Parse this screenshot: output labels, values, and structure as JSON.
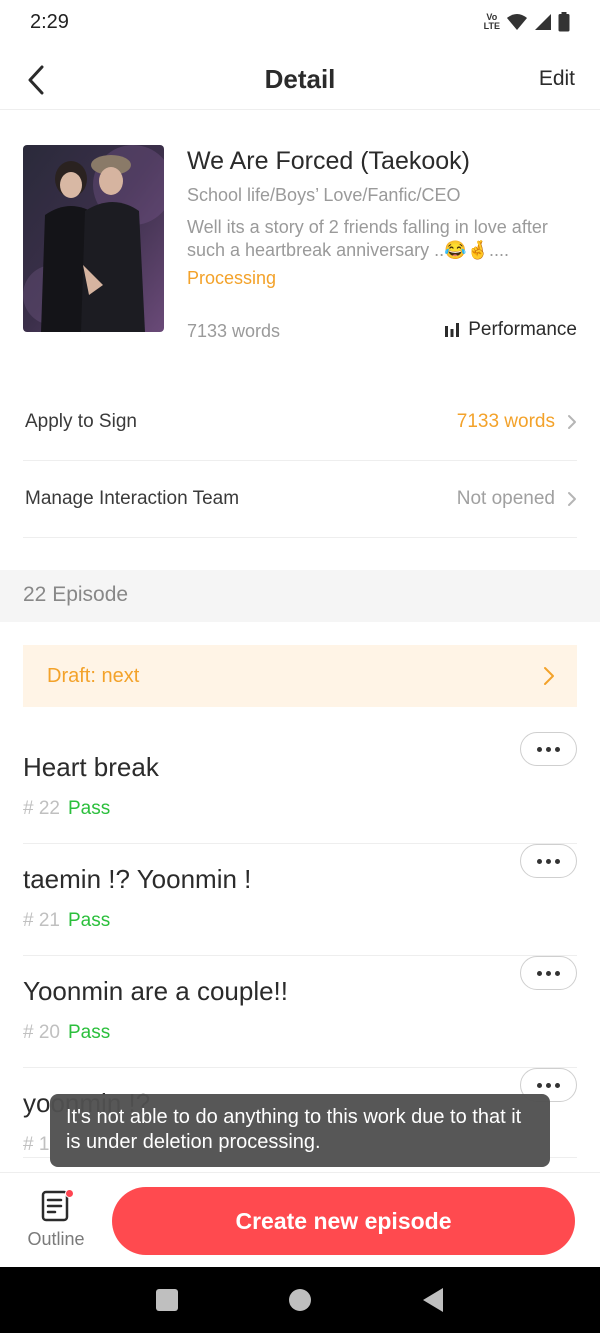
{
  "status_bar": {
    "time": "2:29",
    "volte": "Vo\nLTE",
    "icons": [
      "volte-icon",
      "wifi-icon",
      "signal-icon",
      "battery-icon"
    ]
  },
  "header": {
    "title": "Detail",
    "edit_label": "Edit",
    "back_icon": "chevron-left-icon"
  },
  "book": {
    "cover_icon": "book-cover-image",
    "title": "We Are Forced (Taekook)",
    "tags": "School life/Boys’ Love/Fanfic/CEO",
    "description": "Well its a story of 2 friends falling in love after such a heartbreak anniversary ..😂🤞....",
    "status": "Processing",
    "words": "7133 words",
    "performance_label": "Performance"
  },
  "rows": [
    {
      "label": "Apply to Sign",
      "value": "7133 words"
    },
    {
      "label": "Manage Interaction Team",
      "value": "Not opened"
    }
  ],
  "episodes_section": {
    "label": "22 Episode",
    "draft_label": "Draft: next"
  },
  "episodes": [
    {
      "title": "Heart break",
      "number": "# 22",
      "status": "Pass"
    },
    {
      "title": "taemin !? Yoonmin !",
      "number": "# 21",
      "status": "Pass"
    },
    {
      "title": "Yoonmin are a couple!!",
      "number": "# 20",
      "status": "Pass"
    },
    {
      "title": "yoonmin !?",
      "number": "# 1"
    }
  ],
  "toast": {
    "message": "It's not able to do anything to this work due to that it is under deletion processing."
  },
  "bottom_bar": {
    "outline_label": "Outline",
    "create_label": "Create new episode"
  },
  "colors": {
    "accent_orange": "#f3a22a",
    "pass_green": "#2bbf3c",
    "primary_red": "#ff4a4f",
    "draft_bg": "#fff4e6"
  }
}
